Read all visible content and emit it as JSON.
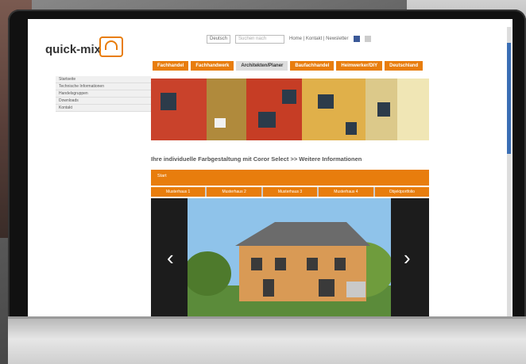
{
  "site": {
    "logo_text": "quick-mix",
    "topbar": {
      "language": "Deutsch",
      "search_placeholder": "Suchen nach",
      "links": "Home | Kontakt | Newsletter"
    },
    "nav_tabs": [
      "Fachhandel",
      "Fachhandwerk",
      "Architekten/Planer",
      "Baufachhandel",
      "Heimwerker/DIY",
      "Deutschland"
    ],
    "active_tab_index": 2,
    "sidebar": [
      "Startseite",
      "Technische Informationen",
      "Handelsgruppen",
      "Downloads",
      "Kontakt"
    ],
    "headline": "Ihre individuelle Farbgestaltung mit Coror Select >> Weitere Informationen",
    "section_tag": "Start",
    "subtabs": [
      "Musterhaus 1",
      "Musterhaus 2",
      "Musterhaus 3",
      "Musterhaus 4",
      "Objektportfolio"
    ],
    "slider": {
      "prev": "‹",
      "next": "›"
    }
  },
  "colors": {
    "accent": "#e87d0d",
    "text": "#555555"
  }
}
